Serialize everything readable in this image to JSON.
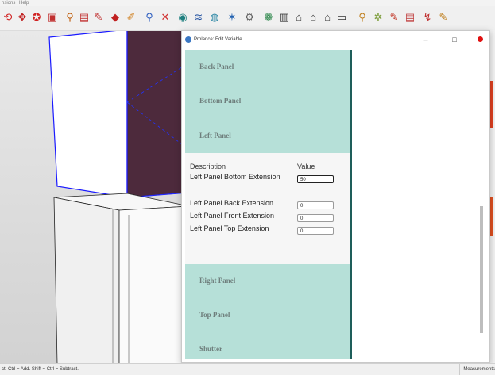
{
  "menubar": {
    "items": [
      "nsions",
      "Help"
    ]
  },
  "toolbar": {
    "icons": [
      {
        "name": "orbit-icon",
        "glyph": "⟲",
        "color": "#d02020"
      },
      {
        "name": "pan-icon",
        "glyph": "✥",
        "color": "#c02020"
      },
      {
        "name": "rotate-icon",
        "glyph": "✪",
        "color": "#d02020"
      },
      {
        "name": "scale-icon",
        "glyph": "▣",
        "color": "#c03030"
      },
      {
        "name": "tape-icon",
        "glyph": "⚲",
        "color": "#c06010"
      },
      {
        "name": "text-icon",
        "glyph": "▤",
        "color": "#c03030"
      },
      {
        "name": "paint-icon",
        "glyph": "✎",
        "color": "#c03030"
      },
      {
        "name": "section-icon",
        "glyph": "◆",
        "color": "#c02020"
      },
      {
        "name": "walk-icon",
        "glyph": "✐",
        "color": "#d08020"
      },
      {
        "name": "zoom-icon",
        "glyph": "⚲",
        "color": "#3060c0"
      },
      {
        "name": "zoom-extents-icon",
        "glyph": "✕",
        "color": "#d03030"
      },
      {
        "name": "component-icon",
        "glyph": "◉",
        "color": "#208080"
      },
      {
        "name": "pattern-icon",
        "glyph": "≋",
        "color": "#2050a0"
      },
      {
        "name": "material-icon",
        "glyph": "◍",
        "color": "#2080a0"
      },
      {
        "name": "style-icon",
        "glyph": "✶",
        "color": "#2060b0"
      },
      {
        "name": "settings-icon",
        "glyph": "⚙",
        "color": "#666666"
      },
      {
        "name": "globe-icon",
        "glyph": "❁",
        "color": "#208040"
      },
      {
        "name": "book-icon",
        "glyph": "▥",
        "color": "#333333"
      },
      {
        "name": "home-icon",
        "glyph": "⌂",
        "color": "#333333"
      },
      {
        "name": "house-icon",
        "glyph": "⌂",
        "color": "#333333"
      },
      {
        "name": "house-outline-icon",
        "glyph": "⌂",
        "color": "#333333"
      },
      {
        "name": "box-icon",
        "glyph": "▭",
        "color": "#333333"
      },
      {
        "name": "wand-icon",
        "glyph": "⚲",
        "color": "#c08020"
      },
      {
        "name": "sparkle-icon",
        "glyph": "✲",
        "color": "#80a040"
      },
      {
        "name": "pencil-icon",
        "glyph": "✎",
        "color": "#c03020"
      },
      {
        "name": "doc-icon",
        "glyph": "▤",
        "color": "#c04040"
      },
      {
        "name": "arrow-icon",
        "glyph": "↯",
        "color": "#c03030"
      },
      {
        "name": "brush-icon",
        "glyph": "✎",
        "color": "#c08020"
      }
    ]
  },
  "dialog": {
    "title": "Prolance: Edit Variable",
    "minimize_glyph": "–",
    "maximize_glyph": "□",
    "sections_top": [
      {
        "label": "Back Panel"
      },
      {
        "label": "Bottom Panel"
      },
      {
        "label": "Left Panel"
      }
    ],
    "open_section": {
      "header_description": "Description",
      "header_value": "Value",
      "rows": [
        {
          "label": "Left Panel Bottom Extension",
          "value": "50"
        },
        {
          "label": "Left Panel Back Extension",
          "value": "0"
        },
        {
          "label": "Left Panel Front Extension",
          "value": "0"
        },
        {
          "label": "Left Panel Top Extension",
          "value": "0"
        }
      ]
    },
    "sections_bottom": [
      {
        "label": "Right Panel"
      },
      {
        "label": "Top Panel"
      },
      {
        "label": "Shutter"
      }
    ]
  },
  "statusbar": {
    "hint": "ct. Ctrl = Add. Shift + Ctrl = Subtract.",
    "measurements": "Measurements"
  },
  "colors": {
    "accordion": "#b6e0d8",
    "accent_border": "#1e5e5a",
    "model_top": "#4d2a3c",
    "model_edge": "#1a1aff"
  }
}
